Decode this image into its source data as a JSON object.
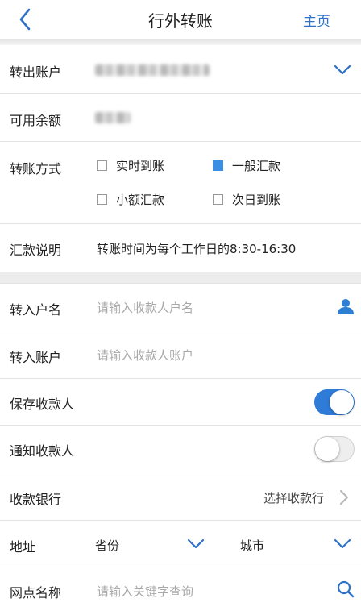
{
  "header": {
    "title": "行外转账",
    "home_label": "主页"
  },
  "form": {
    "out_account": {
      "label": "转出账户"
    },
    "balance": {
      "label": "可用余额"
    },
    "transfer_method": {
      "label": "转账方式",
      "options": [
        {
          "label": "实时到账",
          "checked": false
        },
        {
          "label": "一般汇款",
          "checked": true
        },
        {
          "label": "小额汇款",
          "checked": false
        },
        {
          "label": "次日到账",
          "checked": false
        }
      ]
    },
    "remark": {
      "label": "汇款说明",
      "value": "转账时间为每个工作日的8:30-16:30"
    },
    "payee_name": {
      "label": "转入户名",
      "placeholder": "请输入收款人户名"
    },
    "payee_account": {
      "label": "转入账户",
      "placeholder": "请输入收款人账户"
    },
    "save_payee": {
      "label": "保存收款人",
      "on": true
    },
    "notify_payee": {
      "label": "通知收款人",
      "on": false
    },
    "bank": {
      "label": "收款银行",
      "value": "选择收款行"
    },
    "address": {
      "label": "地址",
      "province": "省份",
      "city": "城市"
    },
    "branch": {
      "label": "网点名称",
      "placeholder": "请输入关键字查询"
    }
  },
  "colors": {
    "accent": "#2e7bd8",
    "checkbox_checked": "#3a8ee3",
    "link": "#2d72c6"
  }
}
